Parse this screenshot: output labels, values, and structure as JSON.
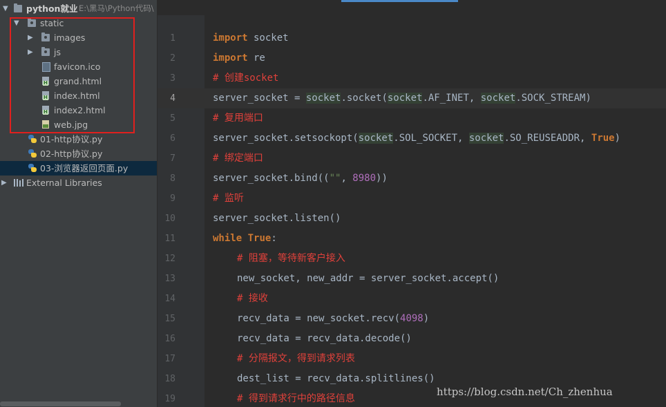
{
  "project": {
    "name": "python就业",
    "path": "E:\\黑马\\Python代码\\"
  },
  "tree": {
    "static": "static",
    "images": "images",
    "js": "js",
    "favicon": "favicon.ico",
    "grand": "grand.html",
    "index": "index.html",
    "index2": "index2.html",
    "webjpg": "web.jpg",
    "py1": "01-http协议.py",
    "py2": "02-http协议.py",
    "py3": "03-浏览器返回页面.py",
    "external": "External Libraries"
  },
  "editor": {
    "line_numbers": [
      "1",
      "2",
      "3",
      "4",
      "5",
      "6",
      "7",
      "8",
      "9",
      "10",
      "11",
      "12",
      "13",
      "14",
      "15",
      "16",
      "17",
      "18",
      "19"
    ],
    "current_line": "4",
    "lines": {
      "l1": {
        "kw": "import",
        "t": " socket"
      },
      "l2": {
        "kw": "import",
        "t": " re"
      },
      "l3": {
        "c": "# 创建socket"
      },
      "l4": {
        "a": "server_socket = ",
        "m1": "socket",
        "b": ".socket(",
        "m2": "socket",
        "c2": ".AF_INET, ",
        "m3": "socket",
        "d": ".SOCK_STREAM)"
      },
      "l5": {
        "c": "# 复用端口"
      },
      "l6": {
        "a": "server_socket.setsockopt(",
        "m1": "socket",
        "b": ".SOL_SOCKET, ",
        "m2": "socket",
        "c2": ".SO_REUSEADDR, ",
        "kw": "True",
        "d": ")"
      },
      "l7": {
        "c": "# 绑定端口"
      },
      "l8": {
        "a": "server_socket.bind((",
        "s": "\"\"",
        "b": ", ",
        "n": "8980",
        "d": "))"
      },
      "l9": {
        "c": "# 监听"
      },
      "l10": {
        "t": "server_socket.listen()"
      },
      "l11": {
        "kw1": "while",
        "sp": " ",
        "kw2": "True",
        "t": ":"
      },
      "l12": {
        "c": "# 阻塞，等待新客户接入"
      },
      "l13": {
        "t": "new_socket, new_addr = server_socket.accept()"
      },
      "l14": {
        "c": "# 接收"
      },
      "l15": {
        "a": "recv_data = new_socket.recv(",
        "n": "4098",
        "d": ")"
      },
      "l16": {
        "t": "recv_data = recv_data.decode()"
      },
      "l17": {
        "c": "# 分隔报文，得到请求列表"
      },
      "l18": {
        "t": "dest_list = recv_data.splitlines()"
      },
      "l19": {
        "c": "# 得到请求行中的路径信息"
      }
    }
  },
  "watermark": "https://blog.csdn.net/Ch_zhenhua",
  "colors": {
    "keyword": "#cc7832",
    "comment": "#e0413b",
    "number": "#b06fbc",
    "annotation_box": "#e1201e",
    "selection": "#0d293e"
  }
}
